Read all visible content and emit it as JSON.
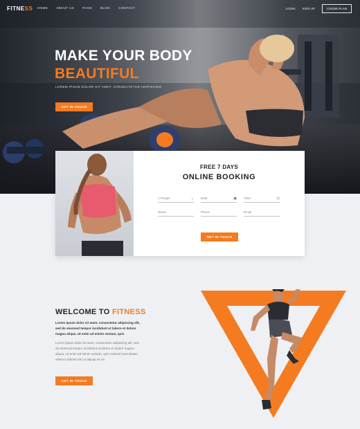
{
  "nav": {
    "logo_main": "FITNE",
    "logo_accent": "SS",
    "links": [
      "HOME",
      "ABOUT US",
      "PAGE",
      "BLOG",
      "CONTACT"
    ],
    "login": "LOGIN",
    "signup": "SIGN UP",
    "cta": "CHOSE PLAN"
  },
  "hero": {
    "title_line1": "MAKE YOUR BODY",
    "title_line2": "BEAUTIFUL",
    "subtitle": "LOREM IPSUM DOLOR SIT AMET, CONSECTETUR ADIPISCING",
    "button": "GET IN TOUCH"
  },
  "booking": {
    "title_small": "FREE 7 DAYS",
    "title_big": "ONLINE BOOKING",
    "fields": {
      "people": "1 People",
      "date": "Date",
      "time": "Time",
      "name": "Name",
      "phone": "Phone",
      "email": "Email"
    },
    "button": "GET IN TOUCH"
  },
  "welcome": {
    "title_main": "WELCOME TO ",
    "title_accent": "FITNESS",
    "text_bold": "Lorem ipsum dolor sit amet, consectetur adipiscing elit, sed do eiusmod tempor incididunt ut labore et dolore magna aliqua. Ut enim ad minim veniam, quis",
    "text_body": "Lorem ipsum dolor sit amet, consectetur adipiscing elit, sed do eiusmod tempor incididunt ut labore et dolore magna aliqua. Ut enim ad minim veniam, quis nostrud exercitation ullamco laboris nisi ut aliquip ex ea",
    "button": "GET IN TOUCH"
  },
  "colors": {
    "accent": "#f47b20"
  }
}
